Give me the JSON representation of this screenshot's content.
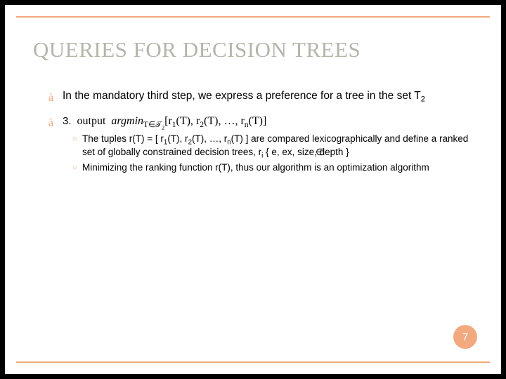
{
  "title": "QUERIES FOR DECISION TREES",
  "bullets": {
    "b1_pre": "In the mandatory third step, we express a preference for a tree in the set T",
    "b1_sub": "2",
    "formula_num": "3.",
    "formula_label": "output",
    "formula_expr_1": "argmin",
    "formula_expr_2": "T∈𝒯",
    "formula_expr_2_sub": "2",
    "formula_expr_3": "[r",
    "formula_r1s": "1",
    "formula_mid1": "(T), r",
    "formula_r2s": "2",
    "formula_mid2": "(T), …, r",
    "formula_rns": "n",
    "formula_end": "(T)]",
    "b2a_1": "The tuples r(T) = [ r",
    "b2a_s1": "1",
    "b2a_2": "(T), r",
    "b2a_s2": "2",
    "b2a_3": "(T), …, r",
    "b2a_sn": "n",
    "b2a_4": "(T) ] are compared lexicographically and define a ranked set of globally constrained decision trees, r",
    "b2a_si": "i",
    "b2a_5": "    { e, ex, size, depth }",
    "b2a_elem": "∈",
    "b2b": "Minimizing the ranking function r(T), thus our algorithm is an optimization algorithm"
  },
  "page": "7"
}
